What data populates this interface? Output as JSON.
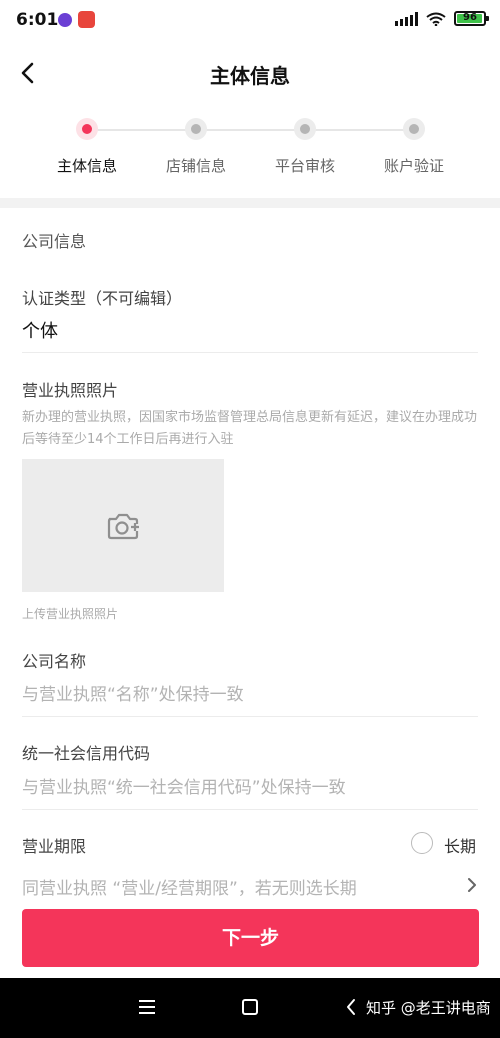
{
  "status_bar": {
    "time": "6:01",
    "battery_level": "96",
    "battery_color": "#3fc24a",
    "icons": [
      "app-notification-icon",
      "app-notification-icon",
      "signal-icon",
      "wifi-icon",
      "battery-icon"
    ]
  },
  "nav": {
    "title": "主体信息",
    "back_icon": "chevron-left-icon"
  },
  "stepper": {
    "accent_color": "#f4355a",
    "steps": [
      {
        "label": "主体信息",
        "active": true
      },
      {
        "label": "店铺信息",
        "active": false
      },
      {
        "label": "平台审核",
        "active": false
      },
      {
        "label": "账户验证",
        "active": false
      }
    ]
  },
  "form": {
    "section_title": "公司信息",
    "cert_type": {
      "label": "认证类型（不可编辑）",
      "value": "个体"
    },
    "license_photo": {
      "label": "营业执照照片",
      "hint": "新办理的营业执照，因国家市场监督管理总局信息更新有延迟，建议在办理成功后等待至少14个工作日后再进行入驻",
      "upload_caption": "上传营业执照照片",
      "upload_icon": "camera-plus-icon"
    },
    "company_name": {
      "label": "公司名称",
      "placeholder": "与营业执照“名称”处保持一致"
    },
    "credit_code": {
      "label": "统一社会信用代码",
      "placeholder": "与营业执照“统一社会信用代码”处保持一致"
    },
    "business_term": {
      "label": "营业期限",
      "long_term_label": "长期",
      "placeholder": "同营业执照 “营业/经营期限”，若无则选长期"
    }
  },
  "footer": {
    "next_label": "下一步"
  },
  "system_nav": {
    "watermark": "知乎 @老王讲电商"
  }
}
